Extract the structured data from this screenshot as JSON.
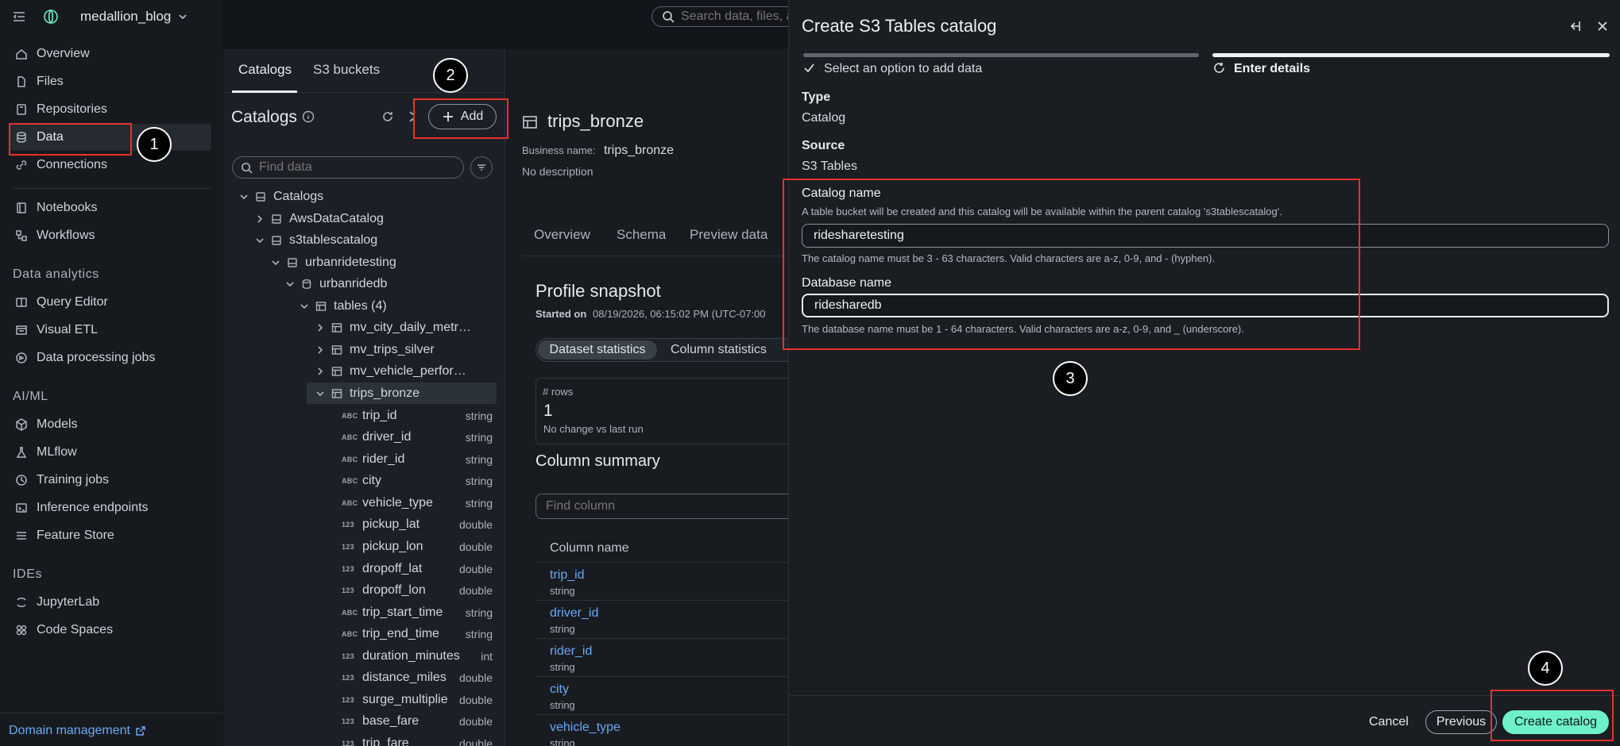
{
  "workspace": {
    "name": "medallion_blog"
  },
  "search": {
    "placeholder": "Search data, files, a"
  },
  "nav": {
    "items_top": [
      "Overview",
      "Files",
      "Repositories",
      "Data",
      "Connections"
    ],
    "items_mid": [
      "Notebooks",
      "Workflows"
    ],
    "section_analytics": "Data analytics",
    "items_analytics": [
      "Query Editor",
      "Visual ETL",
      "Data processing jobs"
    ],
    "section_aiml": "AI/ML",
    "items_aiml": [
      "Models",
      "MLflow",
      "Training jobs",
      "Inference endpoints",
      "Feature Store"
    ],
    "section_ides": "IDEs",
    "items_ides": [
      "JupyterLab",
      "Code Spaces"
    ],
    "footer_link": "Domain management"
  },
  "catalog_panel": {
    "tabs": [
      "Catalogs",
      "S3 buckets"
    ],
    "title": "Catalogs",
    "add_label": "Add",
    "find_placeholder": "Find data",
    "tree": [
      "Catalogs",
      "AwsDataCatalog",
      "s3tablescatalog",
      "urbanridetesting",
      "urbanridedb",
      "tables (4)",
      "mv_city_daily_metr…",
      "mv_trips_silver",
      "mv_vehicle_perfor…",
      "trips_bronze"
    ],
    "columns": [
      {
        "t": "ABC",
        "n": "trip_id",
        "ty": "string"
      },
      {
        "t": "ABC",
        "n": "driver_id",
        "ty": "string"
      },
      {
        "t": "ABC",
        "n": "rider_id",
        "ty": "string"
      },
      {
        "t": "ABC",
        "n": "city",
        "ty": "string"
      },
      {
        "t": "ABC",
        "n": "vehicle_type",
        "ty": "string"
      },
      {
        "t": "123",
        "n": "pickup_lat",
        "ty": "double"
      },
      {
        "t": "123",
        "n": "pickup_lon",
        "ty": "double"
      },
      {
        "t": "123",
        "n": "dropoff_lat",
        "ty": "double"
      },
      {
        "t": "123",
        "n": "dropoff_lon",
        "ty": "double"
      },
      {
        "t": "ABC",
        "n": "trip_start_time",
        "ty": "string"
      },
      {
        "t": "ABC",
        "n": "trip_end_time",
        "ty": "string"
      },
      {
        "t": "123",
        "n": "duration_minutes",
        "ty": "int"
      },
      {
        "t": "123",
        "n": "distance_miles",
        "ty": "double"
      },
      {
        "t": "123",
        "n": "surge_multiplie",
        "ty": "double"
      },
      {
        "t": "123",
        "n": "base_fare",
        "ty": "double"
      },
      {
        "t": "123",
        "n": "trip_fare",
        "ty": "double"
      }
    ]
  },
  "table_view": {
    "title": "trips_bronze",
    "business_name_label": "Business name:",
    "business_name": "trips_bronze",
    "description": "No description",
    "tabs": [
      "Overview",
      "Schema",
      "Preview data"
    ],
    "profile_title": "Profile snapshot",
    "started_label": "Started on",
    "started_value": "08/19/2026, 06:15:02 PM (UTC-07:00",
    "stat_tabs": [
      "Dataset statistics",
      "Column statistics"
    ],
    "rows_label": "# rows",
    "rows_value": "1",
    "rows_change": "No change vs last run",
    "column_summary_title": "Column summary",
    "find_column_placeholder": "Find column",
    "column_name_header": "Column name",
    "summary_columns": [
      {
        "n": "trip_id",
        "ty": "string"
      },
      {
        "n": "driver_id",
        "ty": "string"
      },
      {
        "n": "rider_id",
        "ty": "string"
      },
      {
        "n": "city",
        "ty": "string"
      },
      {
        "n": "vehicle_type",
        "ty": "string"
      }
    ]
  },
  "drawer": {
    "title": "Create S3 Tables catalog",
    "step1": "Select an option to add data",
    "step2": "Enter details",
    "type_label": "Type",
    "type_value": "Catalog",
    "source_label": "Source",
    "source_value": "S3 Tables",
    "catalog_name_label": "Catalog name",
    "catalog_name_desc": "A table bucket will be created and this catalog will be available within the parent catalog 's3tablescatalog'.",
    "catalog_name_value": "ridesharetesting",
    "catalog_name_help": "The catalog name must be 3 - 63 characters. Valid characters are a-z, 0-9, and - (hyphen).",
    "database_name_label": "Database name",
    "database_name_value": "ridesharedb",
    "database_name_help": "The database name must be 1 - 64 characters. Valid characters are a-z, 0-9, and _ (underscore).",
    "cancel_label": "Cancel",
    "previous_label": "Previous",
    "create_label": "Create catalog"
  },
  "callouts": [
    "1",
    "2",
    "3",
    "4"
  ],
  "colors": {
    "accent": "#6ef0c8",
    "highlight": "#e5322d",
    "link": "#6aa9f5"
  }
}
